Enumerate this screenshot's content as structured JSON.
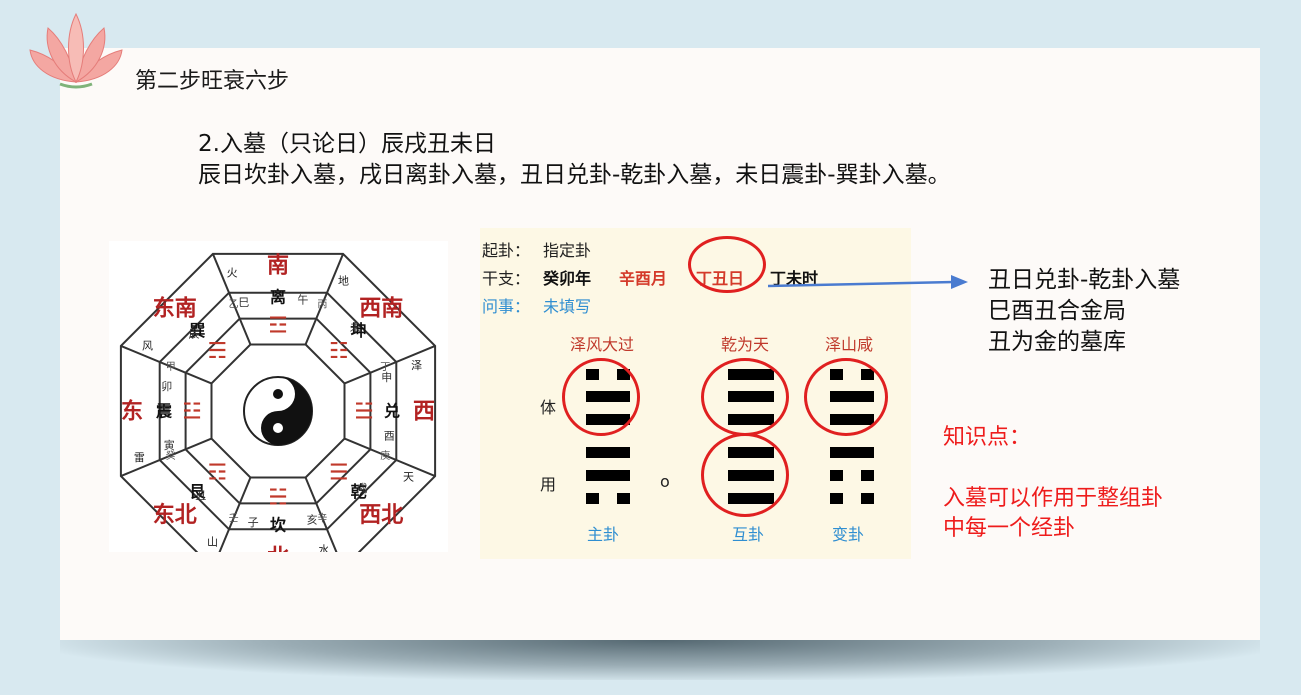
{
  "header": {
    "step_title": "第二步旺衰六步"
  },
  "rule": {
    "line1": "2.入墓（只论日）辰戌丑未日",
    "line2": "辰日坎卦入墓，戌日离卦入墓，丑日兑卦-乾卦入墓，未日震卦-巽卦入墓。"
  },
  "bagua": {
    "center_glyph": "☯",
    "directions": [
      "南",
      "西南",
      "西",
      "西北",
      "北",
      "东北",
      "东",
      "东南"
    ],
    "trigram_names": [
      "离",
      "坤",
      "兑",
      "乾",
      "坎",
      "艮",
      "震",
      "巽"
    ],
    "elements": [
      "火",
      "地",
      "泽",
      "天",
      "水",
      "山",
      "雷",
      "风"
    ],
    "trigram_symbols": [
      "☲",
      "☷",
      "☱",
      "☰",
      "☵",
      "☶",
      "☳",
      "☴"
    ],
    "branches": [
      "午",
      "未",
      "申",
      "酉",
      "戌",
      "亥",
      "子",
      "丑",
      "寅",
      "卯",
      "辰",
      "巳"
    ],
    "stems": [
      "丙",
      "丁",
      "庚",
      "辛",
      "壬",
      "癸",
      "甲",
      "乙"
    ]
  },
  "panel": {
    "qigua_label": "起卦：",
    "qigua_value": "指定卦",
    "ganzhi_label": "干支：",
    "year": "癸卯年",
    "month": "辛酉月",
    "day": "丁丑日",
    "hour": "丁未时",
    "wenshi_label": "问事：",
    "wenshi_value": "未填写",
    "ti_label": "体",
    "yong_label": "用",
    "moving_mark": "o",
    "gua": [
      {
        "name": "泽风大过",
        "label": "主卦",
        "lines": [
          0,
          1,
          1,
          1,
          1,
          0
        ]
      },
      {
        "name": "乾为天",
        "label": "互卦",
        "lines": [
          1,
          1,
          1,
          1,
          1,
          1
        ]
      },
      {
        "name": "泽山咸",
        "label": "变卦",
        "lines": [
          0,
          1,
          1,
          1,
          0,
          0
        ]
      }
    ]
  },
  "notes": {
    "line1": "丑日兑卦-乾卦入墓",
    "line2": "巳酉丑合金局",
    "line3": "丑为金的墓库"
  },
  "knowledge": {
    "title": "知识点：",
    "body1": "入墓可以作用于整组卦",
    "body2": "中每一个经卦"
  },
  "colors": {
    "accent_red": "#e02020",
    "label_blue": "#2f8ed1",
    "arrow_blue": "#4a7bd0",
    "panel_bg": "#fdf8e5"
  }
}
